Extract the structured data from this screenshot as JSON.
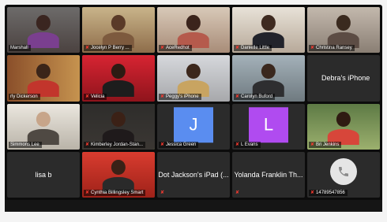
{
  "participants": [
    {
      "name": "Marshall",
      "muted": false
    },
    {
      "name": "Jocelyn P Berry ...",
      "muted": true
    },
    {
      "name": "AceRedhot",
      "muted": true
    },
    {
      "name": "Danielle Little",
      "muted": true
    },
    {
      "name": "Christina Ransey",
      "muted": true
    },
    {
      "name": "rly Dickerson",
      "muted": false
    },
    {
      "name": "Velicia",
      "muted": true
    },
    {
      "name": "Peggy's iPhone",
      "muted": true
    },
    {
      "name": "Carolyn Buford",
      "muted": true
    },
    {
      "name": "Debra's iPhone",
      "muted": false
    },
    {
      "name": "Simmons Lee",
      "muted": false
    },
    {
      "name": "Kimberley Jordan-Stan...",
      "muted": true
    },
    {
      "name": "Jessica Green",
      "muted": true,
      "initial": "J",
      "color": "#5a8df0"
    },
    {
      "name": "L Evans",
      "muted": true,
      "initial": "L",
      "color": "#b04bf0"
    },
    {
      "name": "Bri Jenkins",
      "muted": true
    },
    {
      "name": "lisa b",
      "muted": false
    },
    {
      "name": "Cynthia Billingsley Smart",
      "muted": true
    },
    {
      "name": "Dot Jackson's iPad (...",
      "muted": true
    },
    {
      "name": "Yolanda Franklin Th...",
      "muted": true
    },
    {
      "name": "14789547856",
      "muted": true
    }
  ],
  "mic_glyph": "✘",
  "accent_active": "#a9d63b"
}
